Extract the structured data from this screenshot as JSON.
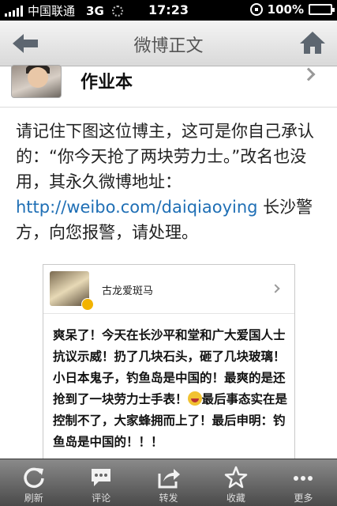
{
  "status": {
    "carrier": "中国联通",
    "network": "3G",
    "time": "17:23",
    "battery": "100%",
    "battery_level": 1.0
  },
  "nav": {
    "title": "微博正文",
    "back_icon": "back-arrow-icon",
    "home_icon": "home-icon"
  },
  "author": {
    "name": "作业本"
  },
  "post": {
    "text_before": "请记住下图这位博主，这可是你自己承认的：“你今天抢了两块劳力士。”改名也没用，其永久微博地址：",
    "link": "http://weibo.com/daiqiaoying",
    "text_after": " 长沙警方，向您报警，请处理。"
  },
  "card": {
    "name": "古龙爱斑马",
    "text_1": "爽呆了！今天在长沙平和堂和广大爱国人士抗议示威！扔了几块石头，砸了几块玻璃！小日本鬼子，钓鱼岛是中国的！最爽的是还抢到了一块劳力士手表！",
    "text_2": "最后事态实在是控制不了，大家蜂拥而上了！最后申明：钓鱼岛是中国的！！！"
  },
  "toolbar": {
    "items": [
      {
        "label": "刷新",
        "icon": "refresh-icon"
      },
      {
        "label": "评论",
        "icon": "comment-icon"
      },
      {
        "label": "转发",
        "icon": "forward-icon"
      },
      {
        "label": "收藏",
        "icon": "star-icon"
      },
      {
        "label": "更多",
        "icon": "more-icon"
      }
    ]
  }
}
